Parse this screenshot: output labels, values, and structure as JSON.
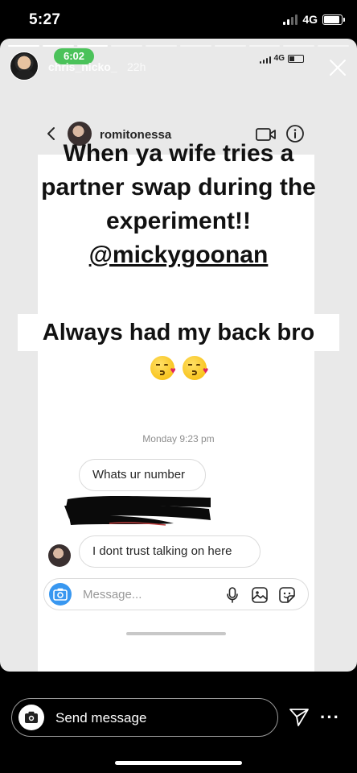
{
  "status_bar": {
    "time": "5:27",
    "network": "4G",
    "battery_percent": 90
  },
  "story": {
    "progress_segments": 10,
    "progress_completed": 3,
    "username": "chris_nicko_",
    "time_ago": "22h"
  },
  "inner_status": {
    "call_timer": "6:02",
    "network": "4G"
  },
  "dm": {
    "header_name": "romitonessa",
    "caption_lines": [
      "When ya wife tries a",
      "partner swap during the",
      "experiment!!"
    ],
    "mention": "@mickygoonan",
    "caption2": "Always had my back bro",
    "emojis": [
      "kissing-face-emoji",
      "kissing-face-emoji"
    ],
    "timestamp": "Monday 9:23 pm",
    "messages": [
      {
        "text": "Whats ur number"
      },
      {
        "text": "I dont trust talking on here"
      }
    ],
    "composer_placeholder": "Message..."
  },
  "reply": {
    "placeholder": "Send message"
  },
  "icons": [
    "close-icon",
    "back-chevron-icon",
    "video-call-icon",
    "info-icon",
    "camera-icon",
    "microphone-icon",
    "gallery-icon",
    "sticker-icon",
    "send-icon",
    "more-icon"
  ],
  "colors": {
    "pill_green": "#4bc25a",
    "camera_blue": "#3897f0",
    "mention_color": "#111111"
  }
}
